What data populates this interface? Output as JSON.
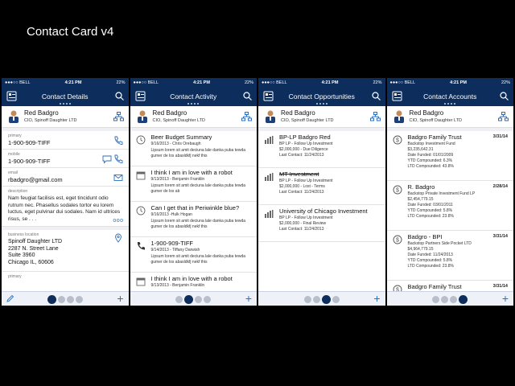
{
  "slide_title": "Contact Card v4",
  "status": {
    "carrier": "●●●○○ BELL",
    "time": "4:21 PM",
    "battery": "22%"
  },
  "contact": {
    "name": "Red Badgro",
    "title": "CIO, Spinoff Daughter LTD"
  },
  "screens": {
    "details": {
      "title": "Contact Details",
      "primary": {
        "label": "primary",
        "value": "1-900-909-TIFF"
      },
      "mobile": {
        "label": "mobile",
        "value": "1-900-909-TIFF"
      },
      "email": {
        "label": "email",
        "value": "rbadgro@gmail.com"
      },
      "description": {
        "label": "description",
        "text": "Nam feugiat facilisis est, eget tincidunt odio rutrum nec. Phasellus sodales tortor eu lorem luctus, eget pulvinar dui sodales. Nam id ultrices risus, se . . .",
        "more": "ooo"
      },
      "location": {
        "label": "business location",
        "lines": [
          "Spinoff Daughter LTD",
          "2287 N. Street Lane",
          "Suite 3960",
          "Chicago IL, 60606"
        ]
      },
      "primary2_label": "primary"
    },
    "activity": {
      "title": "Contact Activity",
      "items": [
        {
          "icon": "clock-icon",
          "title": "Beer Budget Summary",
          "meta": "9/16/2013  -  Chris Orebaugh",
          "body": "Lipsum lorem sit amit deciuna lale danka puba tewda gumer de los abasldkfj nekf this"
        },
        {
          "icon": "calendar-icon",
          "title": "I think I am in love with a robot",
          "meta": "9/13/2013  -  Benjamin Franklin",
          "body": "Lipsum lorem sit amit deciuna lale danka puba tewda gumer de los ab"
        },
        {
          "icon": "clock-icon",
          "title": "Can I get that in Periwinkle blue?",
          "meta": "9/16/2013  -Hulk Hogan",
          "body": "Lipsum lorem sit amit deciuna lale danka puba tewda gumer de los abasldkfj nekf this"
        },
        {
          "icon": "phone-icon",
          "title": "1-900-909-TIFF",
          "meta": "9/14/2013  -  Tiffany Darwish",
          "body": "Lipsum lorem sit amit deciuna lale danka puba tewda gumer de los abasldkfj nekf this"
        },
        {
          "icon": "calendar-icon",
          "title": "I think I am in love with a robot",
          "meta": "9/13/2013  -  Benjamin Franklin",
          "body": ""
        }
      ]
    },
    "opportunities": {
      "title": "Contact Opportunities",
      "items": [
        {
          "title": "BP-LP Badgro Red",
          "lines": [
            "BP LP  -  Follow Up Investment",
            "$2,000,000 - Due Diligence",
            "Last Contact:  11/24/2013"
          ],
          "strike": false
        },
        {
          "title": "MT Investment",
          "lines": [
            "BP LP  -  Follow Up Investment",
            "$2,000,000 - Lost - Terms",
            "Last Contact:  11/24/2013"
          ],
          "strike": true
        },
        {
          "title": "University of Chicago Investment",
          "lines": [
            "BP LP  -  Follow Up Investment",
            "$2,000,000 - Final Review",
            "Last Contact:  11/24/2013"
          ],
          "strike": false
        }
      ]
    },
    "accounts": {
      "title": "Contact Accounts",
      "items": [
        {
          "title": "Badgro Family Trust",
          "date": "3/31/14",
          "lines": [
            "Backstop Investment Fund",
            "$3,235,642.31",
            "Date Funded:  01/01/2009",
            "YTD Compounded:  6.3%",
            "LTD Compounded:  43.8%"
          ]
        },
        {
          "title": "R. Badgro",
          "date": "2/28/14",
          "lines": [
            "Backstop Private Investment Fund LP",
            "$2,454,779.15",
            "Date Funded:  03/01/2011",
            "YTD Compounded:  5.8%",
            "LTD Compounded:  23.8%"
          ]
        },
        {
          "title": "Badgro - BPI",
          "date": "3/31/14",
          "lines": [
            "Backstop Partners Side Pocket LTD",
            "$4,964,779.15",
            "Date Funded:  11/24/2013",
            "YTD Compounded:  5.8%",
            "LTD Compounded:  23.8%"
          ]
        },
        {
          "title": "Badgro Family Trust",
          "date": "3/31/14",
          "lines": []
        }
      ]
    }
  },
  "colors": {
    "navbar": "#0d2d5c",
    "accent": "#2a6fc0"
  }
}
